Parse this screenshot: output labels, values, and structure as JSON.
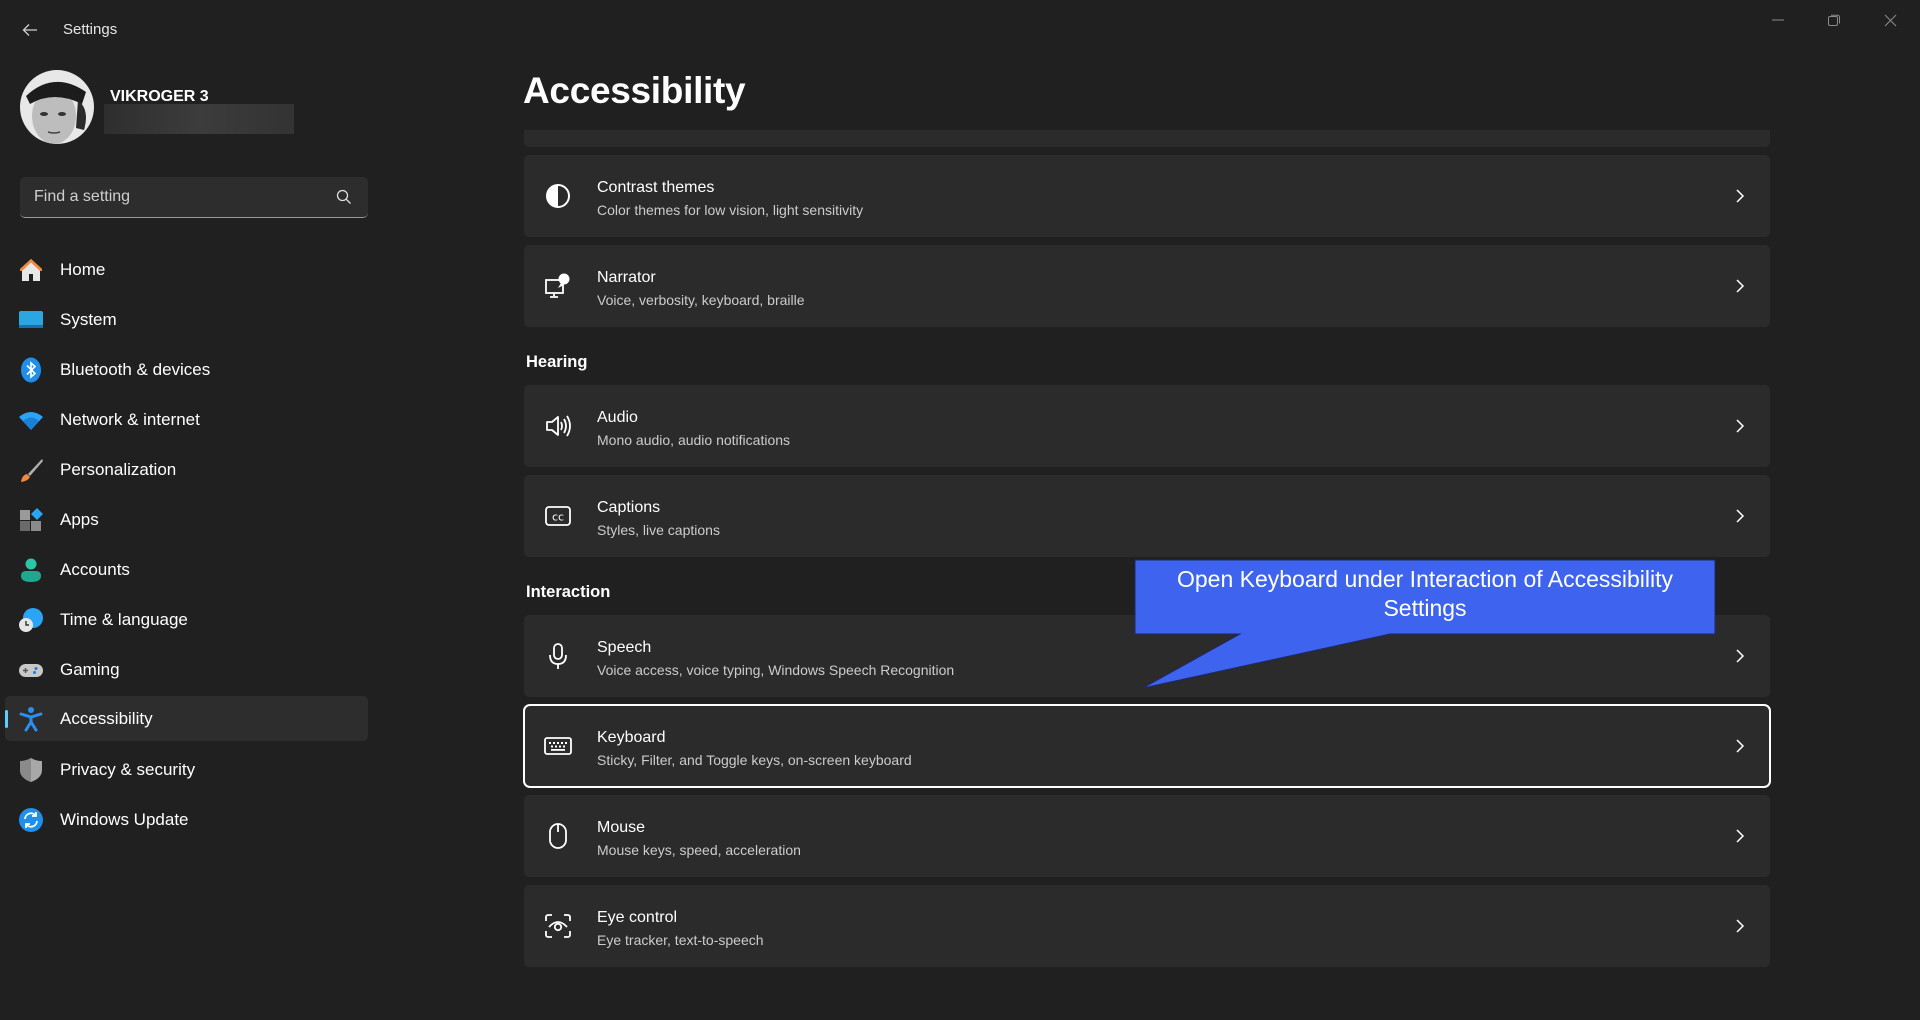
{
  "app": {
    "title": "Settings",
    "window_controls": [
      "minimize",
      "restore",
      "close"
    ]
  },
  "user": {
    "name": "VIKROGER 3",
    "email_redacted": true
  },
  "search": {
    "placeholder": "Find a setting",
    "value": ""
  },
  "sidebar": {
    "items": [
      {
        "label": "Home",
        "icon": "home-icon"
      },
      {
        "label": "System",
        "icon": "system-icon"
      },
      {
        "label": "Bluetooth & devices",
        "icon": "bluetooth-icon"
      },
      {
        "label": "Network & internet",
        "icon": "wifi-icon"
      },
      {
        "label": "Personalization",
        "icon": "brush-icon"
      },
      {
        "label": "Apps",
        "icon": "apps-icon"
      },
      {
        "label": "Accounts",
        "icon": "person-icon"
      },
      {
        "label": "Time & language",
        "icon": "globe-clock-icon"
      },
      {
        "label": "Gaming",
        "icon": "gamepad-icon"
      },
      {
        "label": "Accessibility",
        "icon": "accessibility-icon",
        "selected": true
      },
      {
        "label": "Privacy & security",
        "icon": "shield-icon"
      },
      {
        "label": "Windows Update",
        "icon": "update-icon"
      }
    ]
  },
  "main": {
    "title": "Accessibility",
    "sections": [
      {
        "heading": "",
        "cards": [
          {
            "title": "Contrast themes",
            "subtitle": "Color themes for low vision, light sensitivity",
            "icon": "contrast-icon"
          },
          {
            "title": "Narrator",
            "subtitle": "Voice, verbosity, keyboard, braille",
            "icon": "narrator-icon"
          }
        ]
      },
      {
        "heading": "Hearing",
        "cards": [
          {
            "title": "Audio",
            "subtitle": "Mono audio, audio notifications",
            "icon": "speaker-icon"
          },
          {
            "title": "Captions",
            "subtitle": "Styles, live captions",
            "icon": "captions-icon"
          }
        ]
      },
      {
        "heading": "Interaction",
        "cards": [
          {
            "title": "Speech",
            "subtitle": "Voice access, voice typing, Windows Speech Recognition",
            "icon": "microphone-icon"
          },
          {
            "title": "Keyboard",
            "subtitle": "Sticky, Filter, and Toggle keys, on-screen keyboard",
            "icon": "keyboard-icon",
            "focused": true
          },
          {
            "title": "Mouse",
            "subtitle": "Mouse keys, speed, acceleration",
            "icon": "mouse-icon"
          },
          {
            "title": "Eye control",
            "subtitle": "Eye tracker, text-to-speech",
            "icon": "eye-control-icon"
          }
        ]
      }
    ]
  },
  "annotation": {
    "text": "Open Keyboard under Interaction of Accessibility Settings",
    "color": "#3e63ef"
  },
  "colors": {
    "background": "#202020",
    "card": "#2b2b2b",
    "accent": "#60cdff"
  }
}
